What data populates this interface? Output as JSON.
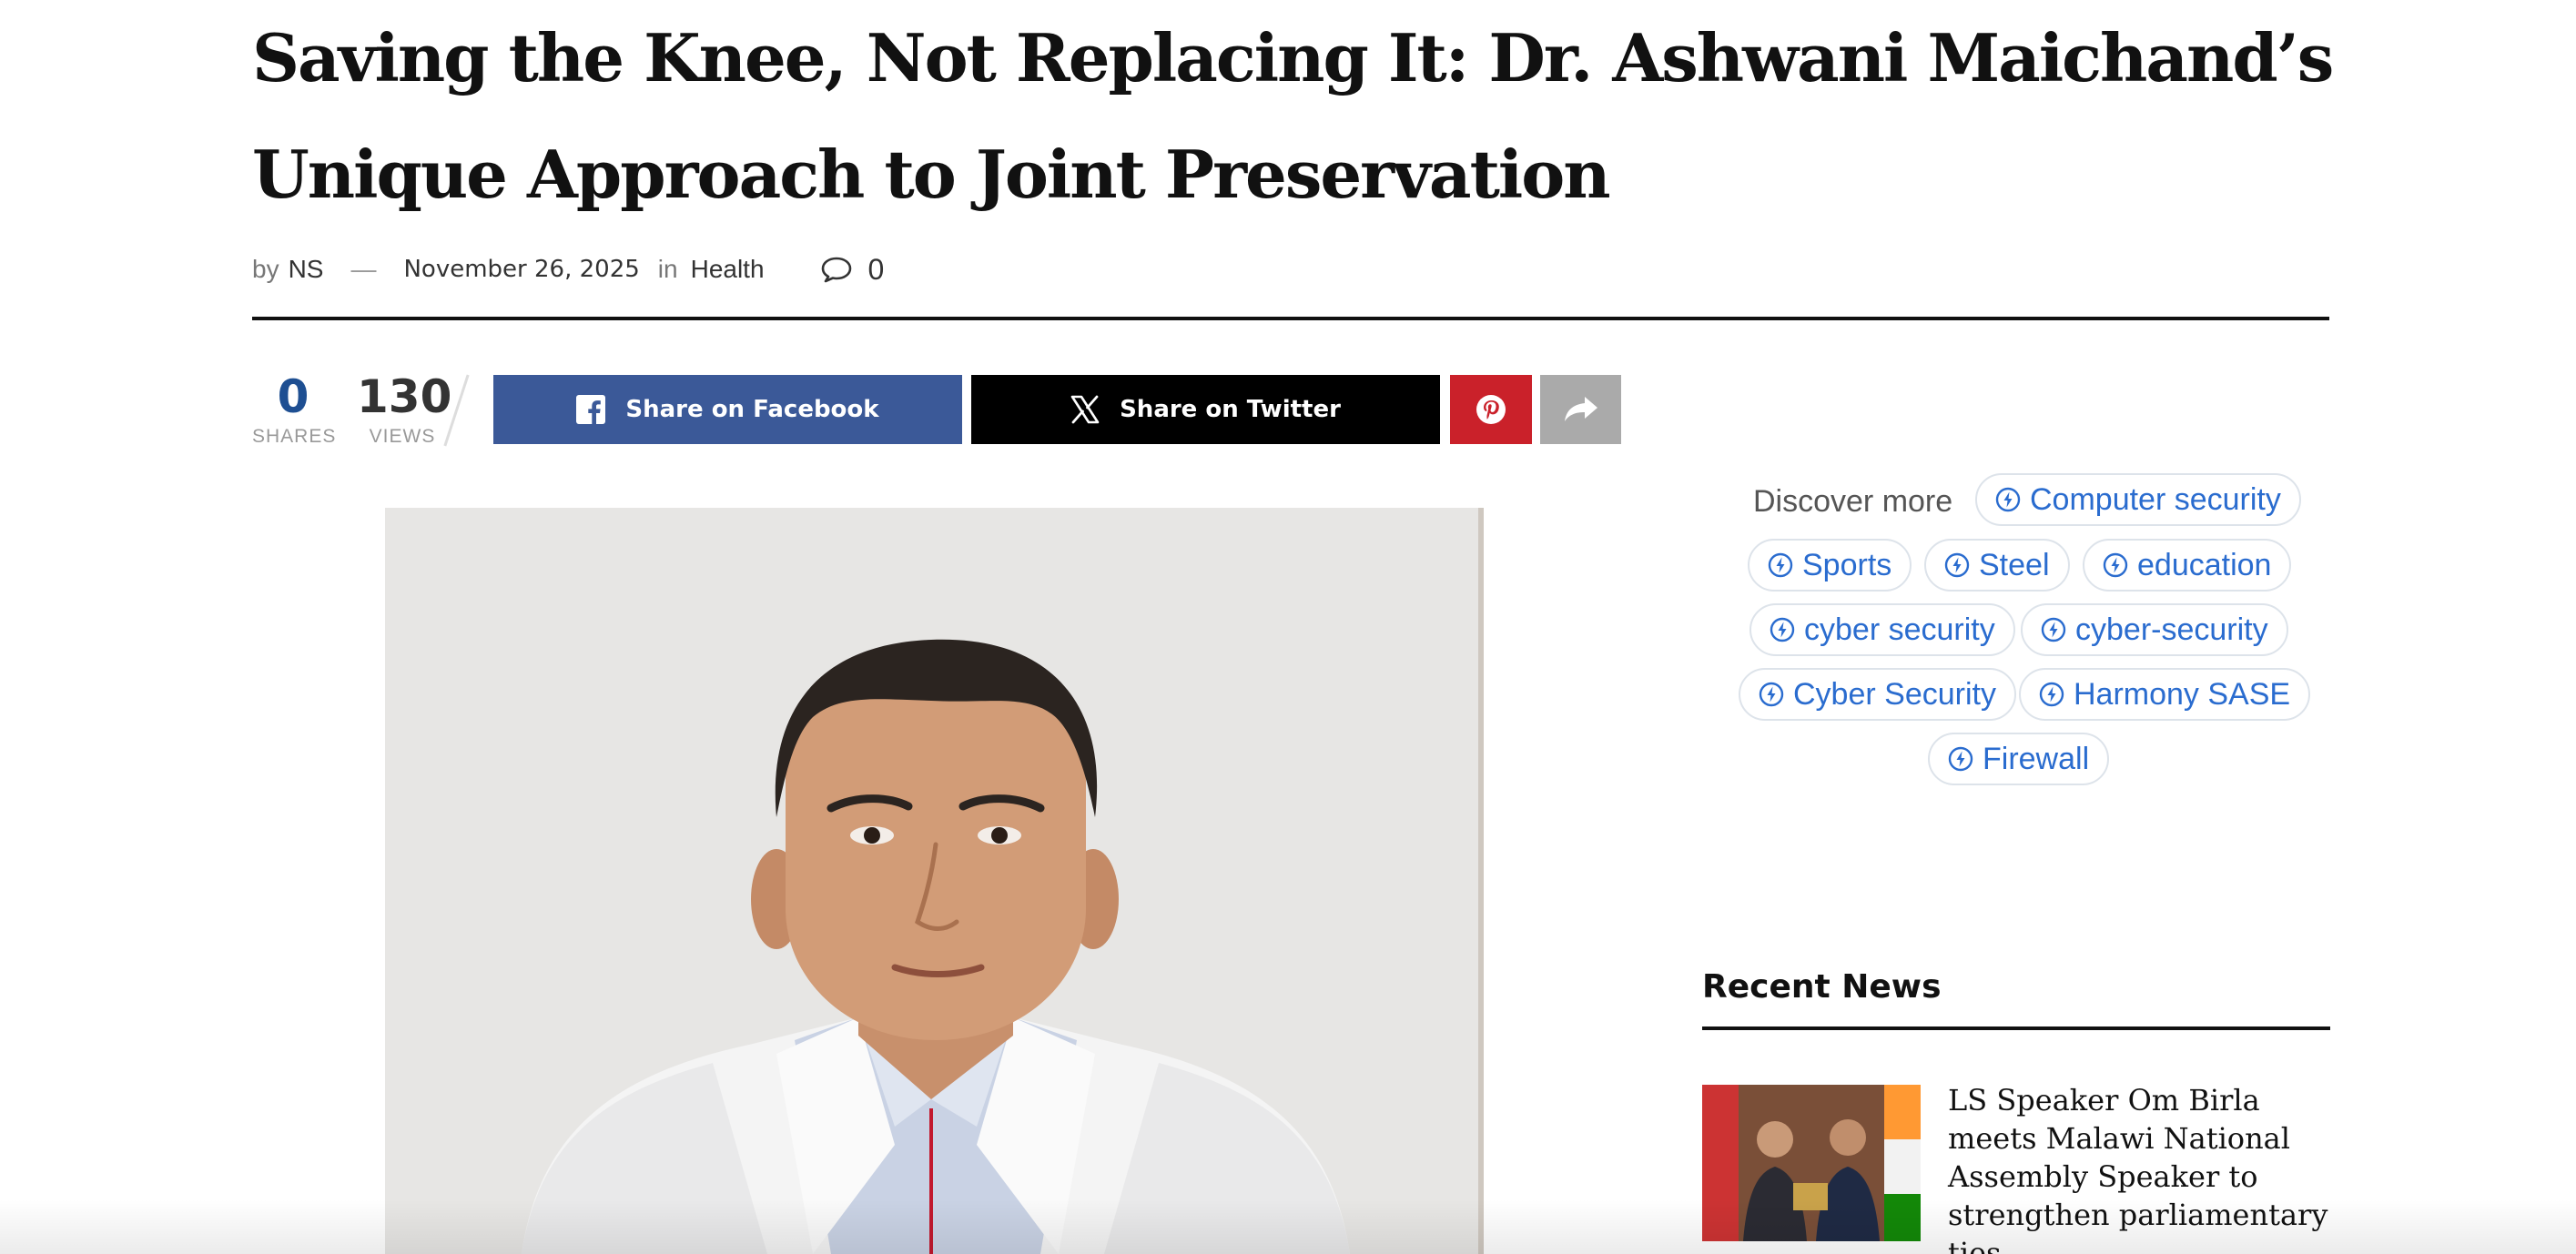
{
  "article": {
    "title": "Saving the Knee, Not Replacing It: Dr. Ashwani Maichand’s Unique Approach to Joint Preservation",
    "meta": {
      "by_label": "by",
      "author": "NS",
      "separator": "—",
      "date": "November 26, 2025",
      "in_label": "in",
      "category": "Health",
      "comment_icon": "comment-bubble-icon",
      "comment_count": "0"
    }
  },
  "share_bar": {
    "shares_count": "0",
    "shares_label": "SHARES",
    "views_count": "130",
    "views_label": "VIEWS",
    "facebook_label": "Share on Facebook",
    "twitter_label": "Share on Twitter",
    "colors": {
      "facebook": "#3b5998",
      "twitter": "#000000",
      "pinterest": "#ca212a",
      "more": "#aaaaaa"
    }
  },
  "discover_more": {
    "label": "Discover more",
    "chip_icon": "bolt-circle-icon",
    "chips": [
      "Computer security",
      "Sports",
      "Steel",
      "education",
      "cyber security",
      "cyber-security",
      "Cyber Security",
      "Harmony SASE",
      "Firewall"
    ],
    "accent": "#2a6ccf"
  },
  "recent_news": {
    "heading": "Recent News",
    "items": [
      {
        "title": "LS Speaker Om Birla meets Malawi National Assembly Speaker to strengthen parliamentary ties"
      }
    ]
  }
}
